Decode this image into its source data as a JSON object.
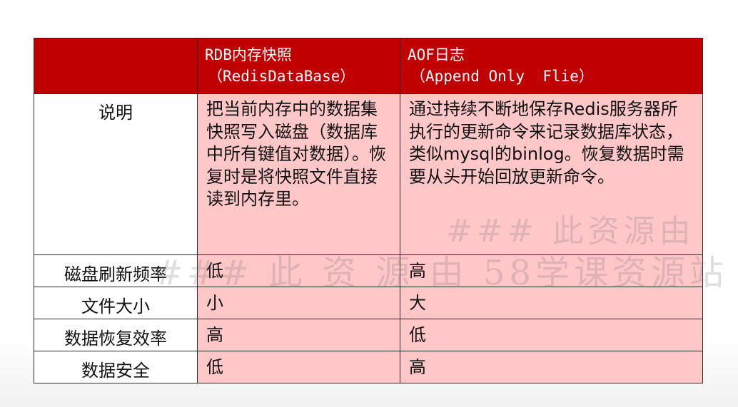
{
  "table": {
    "headers": [
      {
        "line1": "",
        "line2": ""
      },
      {
        "line1": "RDB内存快照",
        "line2": "（RedisDataBase）"
      },
      {
        "line1": "AOF日志",
        "line2": "（Append Only  Flie）"
      }
    ],
    "rows": [
      {
        "label": "说明",
        "rdb": "把当前内存中的数据集快照写入磁盘（数据库中所有键值对数据）。恢复时是将快照文件直接读到内存里。",
        "aof": "通过持续不断地保存Redis服务器所执行的更新命令来记录数据库状态，类似mysql的binlog。恢复数据时需要从头开始回放更新命令。"
      },
      {
        "label": "磁盘刷新频率",
        "rdb": "低",
        "aof": "高"
      },
      {
        "label": "文件大小",
        "rdb": "小",
        "aof": "大"
      },
      {
        "label": "数据恢复效率",
        "rdb": "高",
        "aof": "低"
      },
      {
        "label": "数据安全",
        "rdb": "低",
        "aof": "高"
      }
    ]
  },
  "watermarks": [
    "### 此资源由",
    "###  此 资 源 由 58学课资源站"
  ],
  "colors": {
    "header_bg": "#c00000",
    "cell_bg": "#ffc7c7",
    "border": "#2a2a2a"
  }
}
